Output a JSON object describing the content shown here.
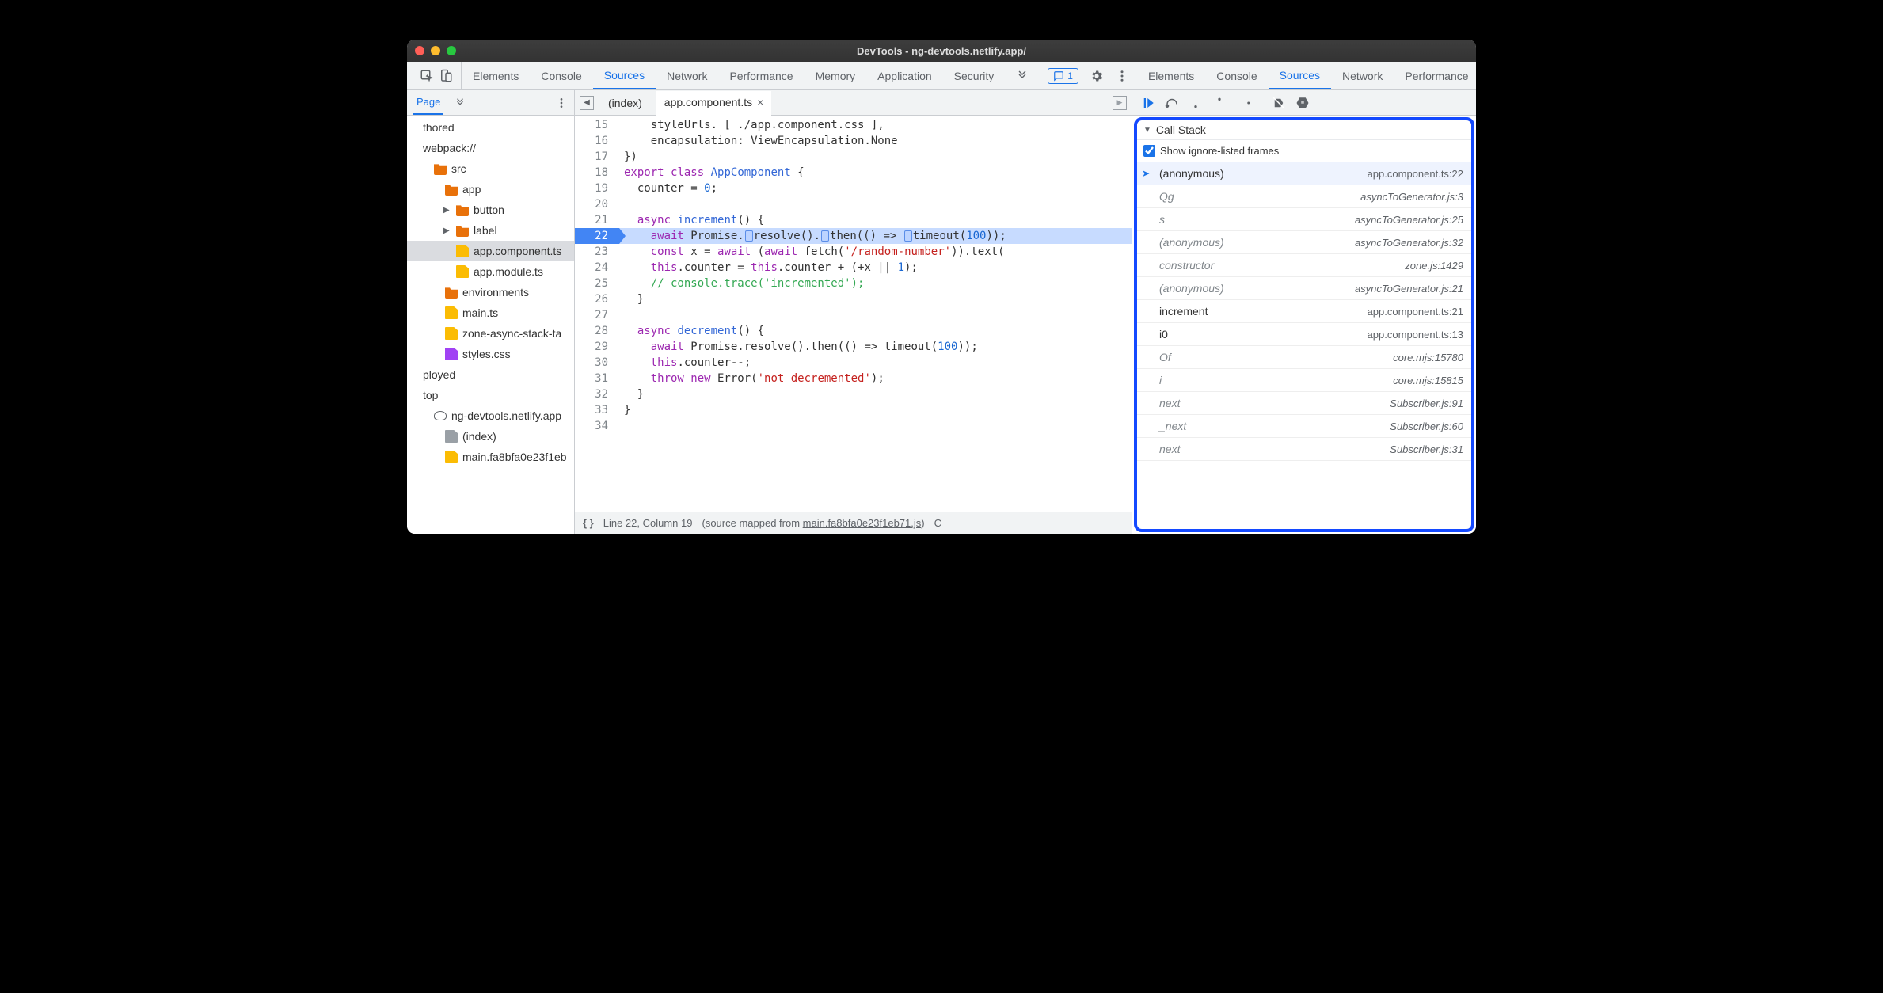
{
  "window": {
    "title": "DevTools - ng-devtools.netlify.app/"
  },
  "tabs": {
    "items": [
      "Elements",
      "Console",
      "Sources",
      "Network",
      "Performance",
      "Memory",
      "Application",
      "Security"
    ],
    "active": 2,
    "message_count": "1"
  },
  "navigator": {
    "tab_label": "Page",
    "nodes": [
      {
        "label": "thored",
        "depth": 0,
        "kind": "text"
      },
      {
        "label": "webpack://",
        "depth": 0,
        "kind": "text"
      },
      {
        "label": "src",
        "depth": 1,
        "kind": "folder"
      },
      {
        "label": "app",
        "depth": 2,
        "kind": "folder"
      },
      {
        "label": "button",
        "depth": 3,
        "kind": "folder",
        "twist": "▶"
      },
      {
        "label": "label",
        "depth": 3,
        "kind": "folder",
        "twist": "▶"
      },
      {
        "label": "app.component.ts",
        "depth": 3,
        "kind": "file",
        "selected": true
      },
      {
        "label": "app.module.ts",
        "depth": 3,
        "kind": "file"
      },
      {
        "label": "environments",
        "depth": 2,
        "kind": "folder"
      },
      {
        "label": "main.ts",
        "depth": 2,
        "kind": "file"
      },
      {
        "label": "zone-async-stack-ta",
        "depth": 2,
        "kind": "file"
      },
      {
        "label": "styles.css",
        "depth": 2,
        "kind": "file",
        "color": "purple"
      },
      {
        "label": "ployed",
        "depth": 0,
        "kind": "text"
      },
      {
        "label": "top",
        "depth": 0,
        "kind": "text"
      },
      {
        "label": "ng-devtools.netlify.app",
        "depth": 1,
        "kind": "cloud"
      },
      {
        "label": "(index)",
        "depth": 2,
        "kind": "file",
        "color": "gray"
      },
      {
        "label": "main.fa8bfa0e23f1eb",
        "depth": 2,
        "kind": "file"
      }
    ]
  },
  "editor": {
    "tabs": {
      "inactive": "(index)",
      "active": "app.component.ts"
    },
    "first_line_no": 15,
    "breakpoint_line": 22,
    "lines": [
      {
        "n": 15,
        "html": "    styleUrls. [ ./app.component.css ],"
      },
      {
        "n": 16,
        "html": "    encapsulation: ViewEncapsulation.None"
      },
      {
        "n": 17,
        "html": "})"
      },
      {
        "n": 18,
        "html": "<span class='tok-kw'>export</span> <span class='tok-kw'>class</span> <span class='tok-cls'>AppComponent</span> {"
      },
      {
        "n": 19,
        "html": "  counter = <span class='tok-num'>0</span>;"
      },
      {
        "n": 20,
        "html": ""
      },
      {
        "n": 21,
        "html": "  <span class='tok-kw'>async</span> <span class='tok-cls'>increment</span>() {"
      },
      {
        "n": 22,
        "hl": true,
        "html": "    <span class='tok-kw'>await</span> Promise.<span class='stepmark'></span>resolve().<span class='stepmark'></span>then(() =&gt; <span class='stepmark'></span>timeout(<span class='tok-num'>100</span>));"
      },
      {
        "n": 23,
        "html": "    <span class='tok-kw'>const</span> x = <span class='tok-kw'>await</span> (<span class='tok-kw'>await</span> fetch(<span class='tok-str'>'/random-number'</span>)).text("
      },
      {
        "n": 24,
        "html": "    <span class='tok-kw'>this</span>.counter = <span class='tok-kw'>this</span>.counter + (+x || <span class='tok-num'>1</span>);"
      },
      {
        "n": 25,
        "html": "    <span class='tok-com'>// console.trace('incremented');</span>"
      },
      {
        "n": 26,
        "html": "  }"
      },
      {
        "n": 27,
        "html": ""
      },
      {
        "n": 28,
        "html": "  <span class='tok-kw'>async</span> <span class='tok-cls'>decrement</span>() {"
      },
      {
        "n": 29,
        "html": "    <span class='tok-kw'>await</span> Promise.resolve().then(() =&gt; timeout(<span class='tok-num'>100</span>));"
      },
      {
        "n": 30,
        "html": "    <span class='tok-kw'>this</span>.counter--;"
      },
      {
        "n": 31,
        "html": "    <span class='tok-kw'>throw new</span> Error(<span class='tok-str'>'not decremented'</span>);"
      },
      {
        "n": 32,
        "html": "  }"
      },
      {
        "n": 33,
        "html": "}"
      },
      {
        "n": 34,
        "html": ""
      }
    ],
    "status": {
      "cursor": "Line 22, Column 19",
      "mapped_prefix": "(source mapped from ",
      "mapped_link": "main.fa8bfa0e23f1eb71.js",
      "mapped_suffix": ")",
      "coverage_hint": "C"
    }
  },
  "debugger": {
    "callstack_title": "Call Stack",
    "show_ignored_label": "Show ignore-listed frames",
    "show_ignored_checked": true,
    "frames": [
      {
        "name": "(anonymous)",
        "loc": "app.component.ts:22",
        "current": true
      },
      {
        "name": "Qg",
        "loc": "asyncToGenerator.js:3",
        "ignored": true
      },
      {
        "name": "s",
        "loc": "asyncToGenerator.js:25",
        "ignored": true
      },
      {
        "name": "(anonymous)",
        "loc": "asyncToGenerator.js:32",
        "ignored": true
      },
      {
        "name": "constructor",
        "loc": "zone.js:1429",
        "ignored": true
      },
      {
        "name": "(anonymous)",
        "loc": "asyncToGenerator.js:21",
        "ignored": true
      },
      {
        "name": "increment",
        "loc": "app.component.ts:21"
      },
      {
        "name": "i0",
        "loc": "app.component.ts:13"
      },
      {
        "name": "Of",
        "loc": "core.mjs:15780",
        "ignored": true
      },
      {
        "name": "i",
        "loc": "core.mjs:15815",
        "ignored": true
      },
      {
        "name": "next",
        "loc": "Subscriber.js:91",
        "ignored": true
      },
      {
        "name": "_next",
        "loc": "Subscriber.js:60",
        "ignored": true
      },
      {
        "name": "next",
        "loc": "Subscriber.js:31",
        "ignored": true
      }
    ]
  }
}
